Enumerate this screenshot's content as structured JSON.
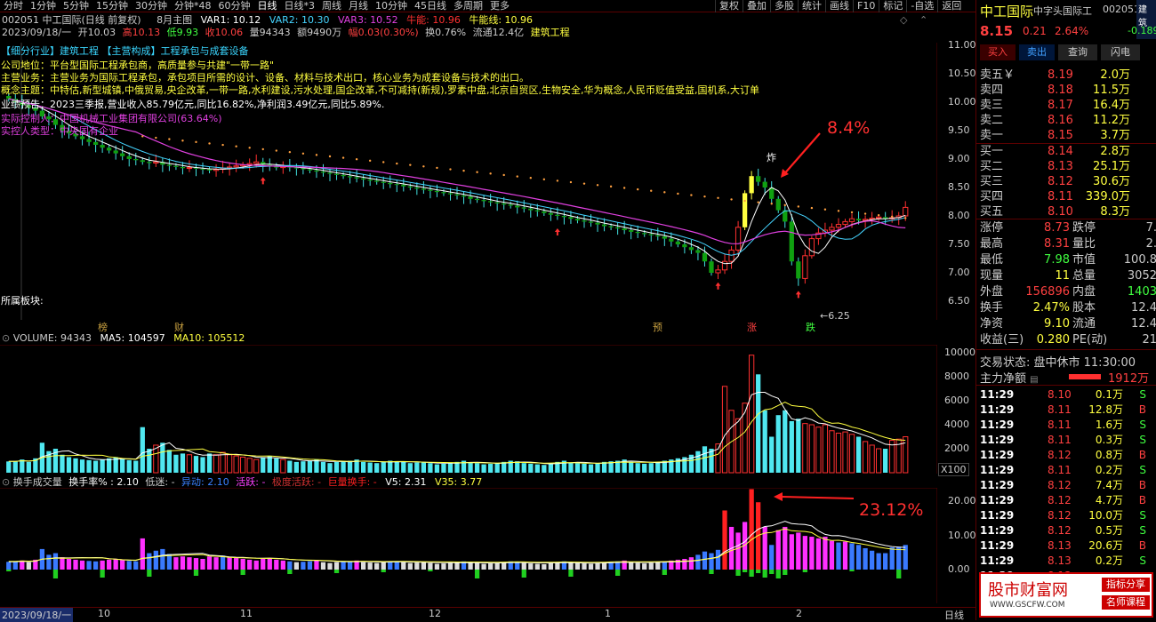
{
  "toolbar": {
    "periods": [
      "分时",
      "1分钟",
      "5分钟",
      "15分钟",
      "30分钟",
      "分钟*48",
      "60分钟",
      "日线",
      "日线*3",
      "周线",
      "月线",
      "10分钟",
      "45日线",
      "多周期",
      "更多"
    ],
    "active": "日线",
    "right_buttons": [
      "复权",
      "叠加",
      "多股",
      "统计",
      "画线",
      "F10",
      "标记",
      "-自选",
      "返回"
    ]
  },
  "header": {
    "code_name": "002051 中工国际(日线 前复权)",
    "indicator": "8月主图",
    "var1": "VAR1: 10.12",
    "var2": "VAR2: 10.30",
    "var3": "VAR3: 10.52",
    "niuneng": "牛能: 10.96",
    "niuxiang": "牛能线: 10.96",
    "date": "2023/09/18/一",
    "open": "开10.03",
    "high": "高10.13",
    "low": "低9.93",
    "close": "收10.06",
    "vol": "量94343",
    "amount": "额9490万",
    "change": "幅0.03(0.30%)",
    "turnover": "换0.76%",
    "float": "流通12.4亿",
    "sector": "建筑工程"
  },
  "info": {
    "industry": "【细分行业】建筑工程 【主营构成】工程承包与成套设备",
    "position": "公司地位：平台型国际工程承包商，高质量参与共建\"一带一路\"",
    "business": "主营业务：主营业务为国际工程承包，承包项目所需的设计、设备、材料与技术出口，核心业务为成套设备与技术的出口。",
    "concepts": "概念主题：中特估,新型城镇,中俄贸易,央企改革,一带一路,水利建设,污水处理,国企改革,不可减持(新规),罗素中盘,北京自贸区,生物安全,华为概念,人民币贬值受益,国机系,大订单",
    "forecast": "业绩预告：2023三季报,营业收入85.79亿元,同比16.82%,净利润3.49亿元,同比5.89%.",
    "controller": "实际控制人：中国机械工业集团有限公司(63.64%)",
    "controller_type": "实控人类型：中央国有企业",
    "sector_label": "所属板块:"
  },
  "main_chart": {
    "yticks": [
      "11.00",
      "10.50",
      "10.00",
      "9.50",
      "9.00",
      "8.50",
      "8.00",
      "7.50",
      "7.00",
      "6.50"
    ],
    "annot_up": "8.4%",
    "annot_bomb": "炸",
    "low_label": "←6.25",
    "markers": [
      "榜",
      "财",
      "预",
      "涨",
      "跌"
    ]
  },
  "volume": {
    "legend_name": "VOLUME: 94343",
    "ma5": "MA5: 104597",
    "ma10": "MA10: 105512",
    "yticks": [
      "10000",
      "8000",
      "6000",
      "4000",
      "2000"
    ],
    "unit": "X100"
  },
  "turnover_panel": {
    "legend_name": "换手成交量",
    "rate": "换手率% : 2.10",
    "low": "低迷: -",
    "abnormal": "异动: 2.10",
    "active": "活跃: -",
    "extreme": "极度活跃: -",
    "huge": "巨量换手: -",
    "v5": "V5: 2.31",
    "v35": "V35: 3.77",
    "yticks": [
      "20.00",
      "10.00",
      "0.00"
    ],
    "annot": "23.12%"
  },
  "xaxis": {
    "date": "2023/09/18/一",
    "labels": [
      "10",
      "11",
      "12",
      "1",
      "2"
    ],
    "period": "日线"
  },
  "quote": {
    "name": "中工国际",
    "subtitle": "中字头国际工",
    "code": "002051",
    "sector_tab": "建筑",
    "price": "8.15",
    "change": "0.21",
    "pct": "2.64%",
    "other": "-0.189",
    "buttons": [
      "买入",
      "卖出",
      "查询",
      "闪电"
    ],
    "asks": [
      {
        "label": "卖五￥",
        "price": "8.19",
        "vol": "2.0万"
      },
      {
        "label": "卖四",
        "price": "8.18",
        "vol": "11.5万"
      },
      {
        "label": "卖三",
        "price": "8.17",
        "vol": "16.4万"
      },
      {
        "label": "卖二",
        "price": "8.16",
        "vol": "11.2万"
      },
      {
        "label": "卖一",
        "price": "8.15",
        "vol": "3.7万"
      }
    ],
    "bids": [
      {
        "label": "买一",
        "price": "8.14",
        "vol": "2.8万"
      },
      {
        "label": "买二",
        "price": "8.13",
        "vol": "25.1万"
      },
      {
        "label": "买三",
        "price": "8.12",
        "vol": "30.6万"
      },
      {
        "label": "买四",
        "price": "8.11",
        "vol": "339.0万"
      },
      {
        "label": "买五",
        "price": "8.10",
        "vol": "8.3万"
      }
    ],
    "stats": [
      {
        "l1": "涨停",
        "v1": "8.73",
        "l2": "跌停",
        "v2": "7."
      },
      {
        "l1": "最高",
        "v1": "8.31",
        "l2": "量比",
        "v2": "2."
      },
      {
        "l1": "最低",
        "v1": "7.98",
        "l2": "市值",
        "v2": "100.8"
      },
      {
        "l1": "现量",
        "v1": "11",
        "l2": "总量",
        "v2": "3052"
      },
      {
        "l1": "外盘",
        "v1": "156896",
        "l2": "内盘",
        "v2": "1403"
      },
      {
        "l1": "换手",
        "v1": "2.47%",
        "l2": "股本",
        "v2": "12.4"
      },
      {
        "l1": "净资",
        "v1": "9.10",
        "l2": "流通",
        "v2": "12.4"
      },
      {
        "l1": "收益(三)",
        "v1": "0.280",
        "l2": "PE(动)",
        "v2": "21"
      }
    ],
    "status": "交易状态: 盘中休市 11:30:00",
    "main_flow_label": "主力净额",
    "main_flow": "1912万",
    "trades": [
      {
        "t": "11:29",
        "p": "8.10",
        "v": "0.1万",
        "s": "S"
      },
      {
        "t": "11:29",
        "p": "8.11",
        "v": "12.8万",
        "s": "B"
      },
      {
        "t": "11:29",
        "p": "8.11",
        "v": "1.6万",
        "s": "S"
      },
      {
        "t": "11:29",
        "p": "8.11",
        "v": "0.3万",
        "s": "S"
      },
      {
        "t": "11:29",
        "p": "8.12",
        "v": "0.8万",
        "s": "B"
      },
      {
        "t": "11:29",
        "p": "8.11",
        "v": "0.2万",
        "s": "S"
      },
      {
        "t": "11:29",
        "p": "8.12",
        "v": "7.4万",
        "s": "B"
      },
      {
        "t": "11:29",
        "p": "8.12",
        "v": "4.7万",
        "s": "B"
      },
      {
        "t": "11:29",
        "p": "8.12",
        "v": "10.0万",
        "s": "S"
      },
      {
        "t": "11:29",
        "p": "8.12",
        "v": "0.5万",
        "s": "S"
      },
      {
        "t": "11:29",
        "p": "8.13",
        "v": "20.6万",
        "s": "B"
      },
      {
        "t": "11:29",
        "p": "8.13",
        "v": "0.2万",
        "s": "S"
      },
      {
        "t": "11:29",
        "p": "8.13",
        "v": "",
        "s": ""
      }
    ]
  },
  "watermark": {
    "title": "股市财富网",
    "url": "WWW.GSCFW.COM",
    "tag1": "指标分享",
    "tag2": "名师课程"
  },
  "chart_data": {
    "type": "candlestick",
    "price_axis": {
      "min": 6.25,
      "max": 11.0
    },
    "volume_axis": {
      "min": 0,
      "max": 10000,
      "unit": "X100"
    },
    "turnover_axis": {
      "min": 0,
      "max": 20
    },
    "x_labels": [
      "10",
      "11",
      "12",
      "1",
      "2"
    ],
    "closes": [
      10.06,
      10.0,
      9.95,
      9.9,
      9.85,
      9.75,
      9.7,
      9.6,
      9.5,
      9.45,
      9.4,
      9.35,
      9.3,
      9.25,
      9.2,
      9.15,
      9.1,
      9.05,
      9.0,
      8.98,
      8.95,
      8.93,
      8.95,
      8.9,
      8.88,
      8.86,
      8.84,
      8.85,
      8.83,
      8.82,
      8.8,
      8.82,
      8.84,
      8.86,
      8.88,
      8.9,
      8.92,
      8.95,
      8.9,
      8.88,
      8.85,
      8.87,
      8.85,
      8.84,
      8.82,
      8.8,
      8.78,
      8.76,
      8.74,
      8.72,
      8.7,
      8.68,
      8.66,
      8.64,
      8.62,
      8.6,
      8.58,
      8.56,
      8.55,
      8.52,
      8.5,
      8.48,
      8.46,
      8.44,
      8.42,
      8.4,
      8.38,
      8.36,
      8.34,
      8.3,
      8.28,
      8.26,
      8.24,
      8.22,
      8.2,
      8.18,
      8.15,
      8.13,
      8.1,
      8.08,
      8.05,
      8.02,
      8.0,
      7.98,
      7.95,
      7.92,
      7.9,
      7.88,
      7.85,
      7.82,
      7.8,
      7.78,
      7.75,
      7.72,
      7.7,
      7.68,
      7.66,
      7.64,
      7.6,
      7.55,
      7.5,
      7.45,
      7.4,
      7.35,
      7.2,
      7.0,
      7.05,
      7.2,
      7.4,
      7.8,
      8.4,
      8.7,
      8.6,
      8.5,
      8.3,
      8.1,
      7.9,
      7.2,
      6.9,
      7.3,
      7.6,
      7.7,
      7.75,
      7.8,
      7.85,
      7.9,
      7.95,
      7.92,
      7.94,
      7.96,
      7.98,
      7.95,
      7.97,
      8.0,
      8.15
    ],
    "volumes": [
      940,
      950,
      1100,
      900,
      1200,
      2500,
      1800,
      2000,
      1500,
      1300,
      1200,
      1100,
      1050,
      1000,
      1100,
      1200,
      1300,
      1150,
      1050,
      1000,
      3800,
      2000,
      2300,
      2500,
      1900,
      1500,
      1600,
      1500,
      1400,
      1300,
      1600,
      1500,
      1700,
      1500,
      1400,
      1300,
      1200,
      1100,
      1300,
      1400,
      1200,
      1100,
      1000,
      900,
      950,
      1000,
      1100,
      900,
      800,
      900,
      950,
      1000,
      1100,
      900,
      850,
      800,
      900,
      1000,
      950,
      900,
      800,
      850,
      900,
      800,
      700,
      750,
      800,
      900,
      1000,
      850,
      800,
      700,
      750,
      800,
      900,
      1000,
      950,
      800,
      750,
      700,
      650,
      800,
      900,
      1000,
      850,
      800,
      750,
      700,
      800,
      900,
      950,
      1000,
      1100,
      900,
      800,
      750,
      800,
      900,
      1000,
      1100,
      1200,
      1300,
      1500,
      1800,
      2200,
      2000,
      2400,
      7200,
      5200,
      4500,
      5800,
      9800,
      8200,
      5200,
      3000,
      4800,
      5200,
      4300,
      4500,
      4100,
      4000,
      3800,
      4000,
      3500,
      3300,
      3400,
      3200,
      3000,
      2600,
      2300,
      2000,
      2000,
      2700,
      2800,
      3000
    ]
  }
}
